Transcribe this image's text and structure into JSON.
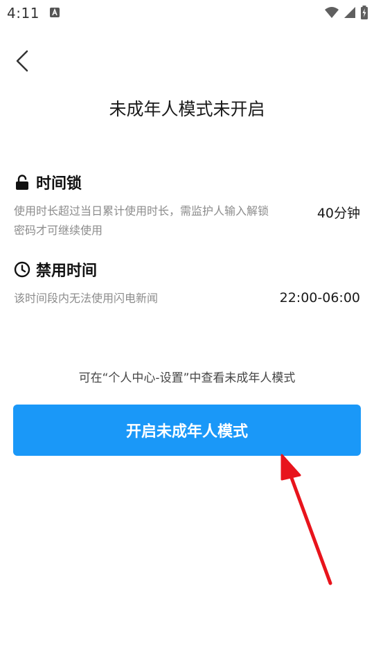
{
  "status_bar": {
    "time": "4:11",
    "notification_icon": "a-letter-icon",
    "icons": [
      "wifi-icon",
      "cellular-signal-icon",
      "battery-charging-icon"
    ]
  },
  "header": {
    "back_icon": "chevron-left-icon",
    "title": "未成年人模式未开启"
  },
  "sections": [
    {
      "icon": "padlock-icon",
      "heading": "时间锁",
      "description": "使用时长超过当日累计使用时长，需监护人输入解锁密码才可继续使用",
      "value": "40分钟"
    },
    {
      "icon": "clock-icon",
      "heading": "禁用时间",
      "description": "该时间段内无法使用闪电新闻",
      "value": "22:00-06:00"
    }
  ],
  "footer": {
    "hint": "可在“个人中心-设置”中查看未成年人模式",
    "button_label": "开启未成年人模式"
  },
  "colors": {
    "accent": "#1a98f8",
    "annotation_arrow": "#e8141c"
  }
}
